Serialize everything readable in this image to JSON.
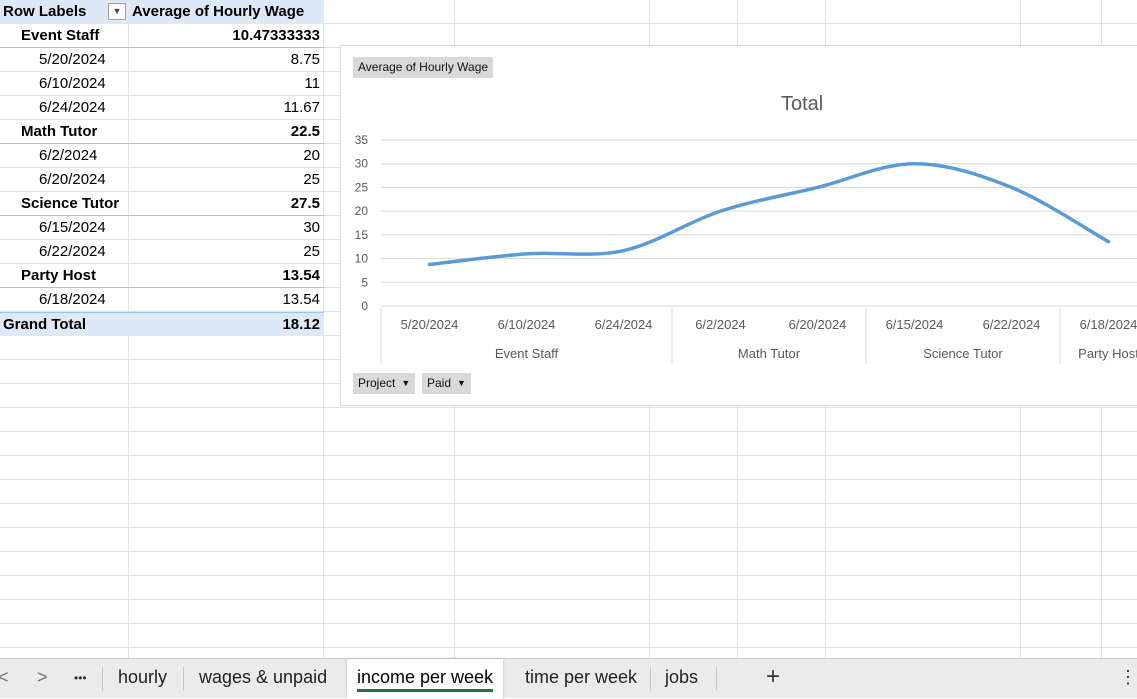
{
  "pivot": {
    "header": {
      "row_labels": "Row Labels",
      "value_field": "Average of Hourly Wage"
    },
    "groups": [
      {
        "label": "Event Staff",
        "value": "10.47333333",
        "items": [
          {
            "label": "5/20/2024",
            "value": "8.75"
          },
          {
            "label": "6/10/2024",
            "value": "11"
          },
          {
            "label": "6/24/2024",
            "value": "11.67"
          }
        ]
      },
      {
        "label": "Math Tutor",
        "value": "22.5",
        "items": [
          {
            "label": "6/2/2024",
            "value": "20"
          },
          {
            "label": "6/20/2024",
            "value": "25"
          }
        ]
      },
      {
        "label": "Science Tutor",
        "value": "27.5",
        "items": [
          {
            "label": "6/15/2024",
            "value": "30"
          },
          {
            "label": "6/22/2024",
            "value": "25"
          }
        ]
      },
      {
        "label": "Party Host",
        "value": "13.54",
        "items": [
          {
            "label": "6/18/2024",
            "value": "13.54"
          }
        ]
      }
    ],
    "grand_total": {
      "label": "Grand Total",
      "value": "18.12"
    }
  },
  "chart": {
    "value_button": "Average of Hourly Wage",
    "filter_buttons": [
      "Project",
      "Paid"
    ]
  },
  "chart_data": {
    "type": "line",
    "title": "Total",
    "categories": [
      "5/20/2024",
      "6/10/2024",
      "6/24/2024",
      "6/2/2024",
      "6/20/2024",
      "6/15/2024",
      "6/22/2024",
      "6/18/2024"
    ],
    "category_groups": [
      {
        "name": "Event Staff",
        "count": 3
      },
      {
        "name": "Math Tutor",
        "count": 2
      },
      {
        "name": "Science Tutor",
        "count": 2
      },
      {
        "name": "Party Host",
        "count": 1
      }
    ],
    "values": [
      8.75,
      11,
      11.67,
      20,
      25,
      30,
      25,
      13.54
    ],
    "ylim": [
      0,
      35
    ],
    "yticks": [
      0,
      5,
      10,
      15,
      20,
      25,
      30,
      35
    ],
    "smooth": true,
    "grid": true,
    "legend": "none",
    "line_color": "#5b9bd5"
  },
  "sheet_tabs": {
    "nav_prev": "<",
    "nav_next": ">",
    "overflow": "•••",
    "tabs": [
      "hourly",
      "wages & unpaid",
      "income per week",
      "time per week",
      "jobs"
    ],
    "active_index": 2,
    "add": "+",
    "menu": "⋮"
  }
}
